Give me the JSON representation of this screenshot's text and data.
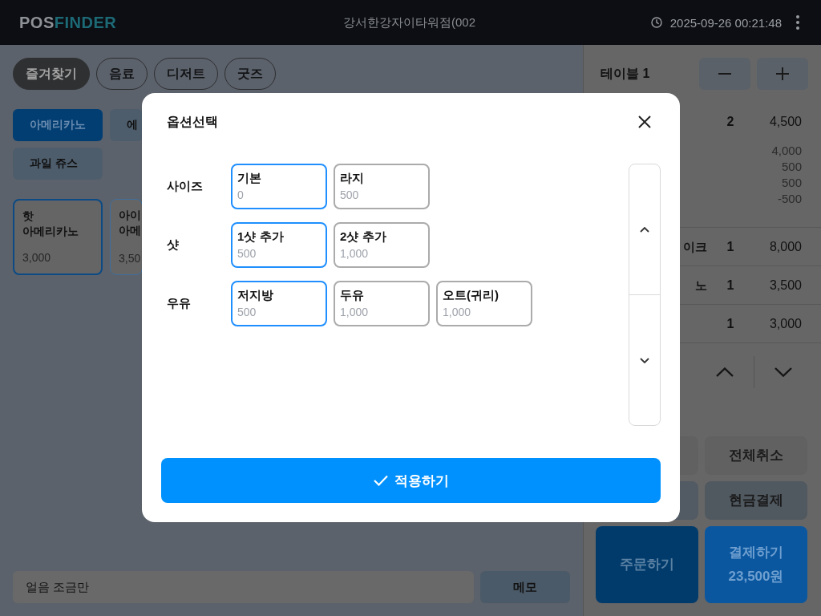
{
  "top_bar": {
    "logo": {
      "prefix": "POS",
      "suffix": "FINDER"
    },
    "store_name": "강서한강자이타워점(002",
    "datetime": "2025-09-26 00:21:48"
  },
  "category_tabs": [
    {
      "label": "즐겨찾기",
      "selected": true
    },
    {
      "label": "음료",
      "selected": false
    },
    {
      "label": "디저트",
      "selected": false
    },
    {
      "label": "굿즈",
      "selected": false
    }
  ],
  "menu_groups": [
    {
      "label": "아메리카노",
      "selected": true
    },
    {
      "label": "에",
      "selected": false
    },
    {
      "label": "과일 쥬스",
      "selected": false
    }
  ],
  "menu_items": [
    {
      "name": "핫\n아메리카노",
      "price": "3,000",
      "selected": true
    },
    {
      "name": "아이\n아메",
      "price": "3,50",
      "selected": false
    }
  ],
  "memo": {
    "value": "얼음 조금만",
    "button": "메모"
  },
  "order_panel": {
    "table_name": "테이블 1",
    "rows": [
      {
        "quantity": "2",
        "price": "4,500",
        "option_prices": [
          "4,000",
          "500",
          "500",
          "-500"
        ]
      },
      {
        "name": "이크",
        "quantity": "1",
        "price": "8,000"
      },
      {
        "name": "노",
        "quantity": "1",
        "price": "3,500"
      },
      {
        "quantity": "1",
        "price": "3,000"
      }
    ],
    "actions": [
      {
        "kind": "cancel",
        "label": "전체취소"
      },
      {
        "kind": "cash",
        "label": "현금결제"
      },
      {
        "kind": "order",
        "label": "주문하기"
      },
      {
        "kind": "pay",
        "label": "결제하기",
        "amount": "23,500원"
      }
    ]
  },
  "option_dialog": {
    "title": "옵션선택",
    "groups": [
      {
        "label": "사이즈",
        "options": [
          {
            "name": "기본",
            "price": "0",
            "selected": true
          },
          {
            "name": "라지",
            "price": "500",
            "selected": false
          }
        ]
      },
      {
        "label": "샷",
        "options": [
          {
            "name": "1샷 추가",
            "price": "500",
            "selected": true
          },
          {
            "name": "2샷 추가",
            "price": "1,000",
            "selected": false
          }
        ]
      },
      {
        "label": "우유",
        "options": [
          {
            "name": "저지방",
            "price": "500",
            "selected": true
          },
          {
            "name": "두유",
            "price": "1,000",
            "selected": false
          },
          {
            "name": "오트(귀리)",
            "price": "1,000",
            "selected": false
          }
        ]
      }
    ],
    "apply_button": "적용하기"
  }
}
